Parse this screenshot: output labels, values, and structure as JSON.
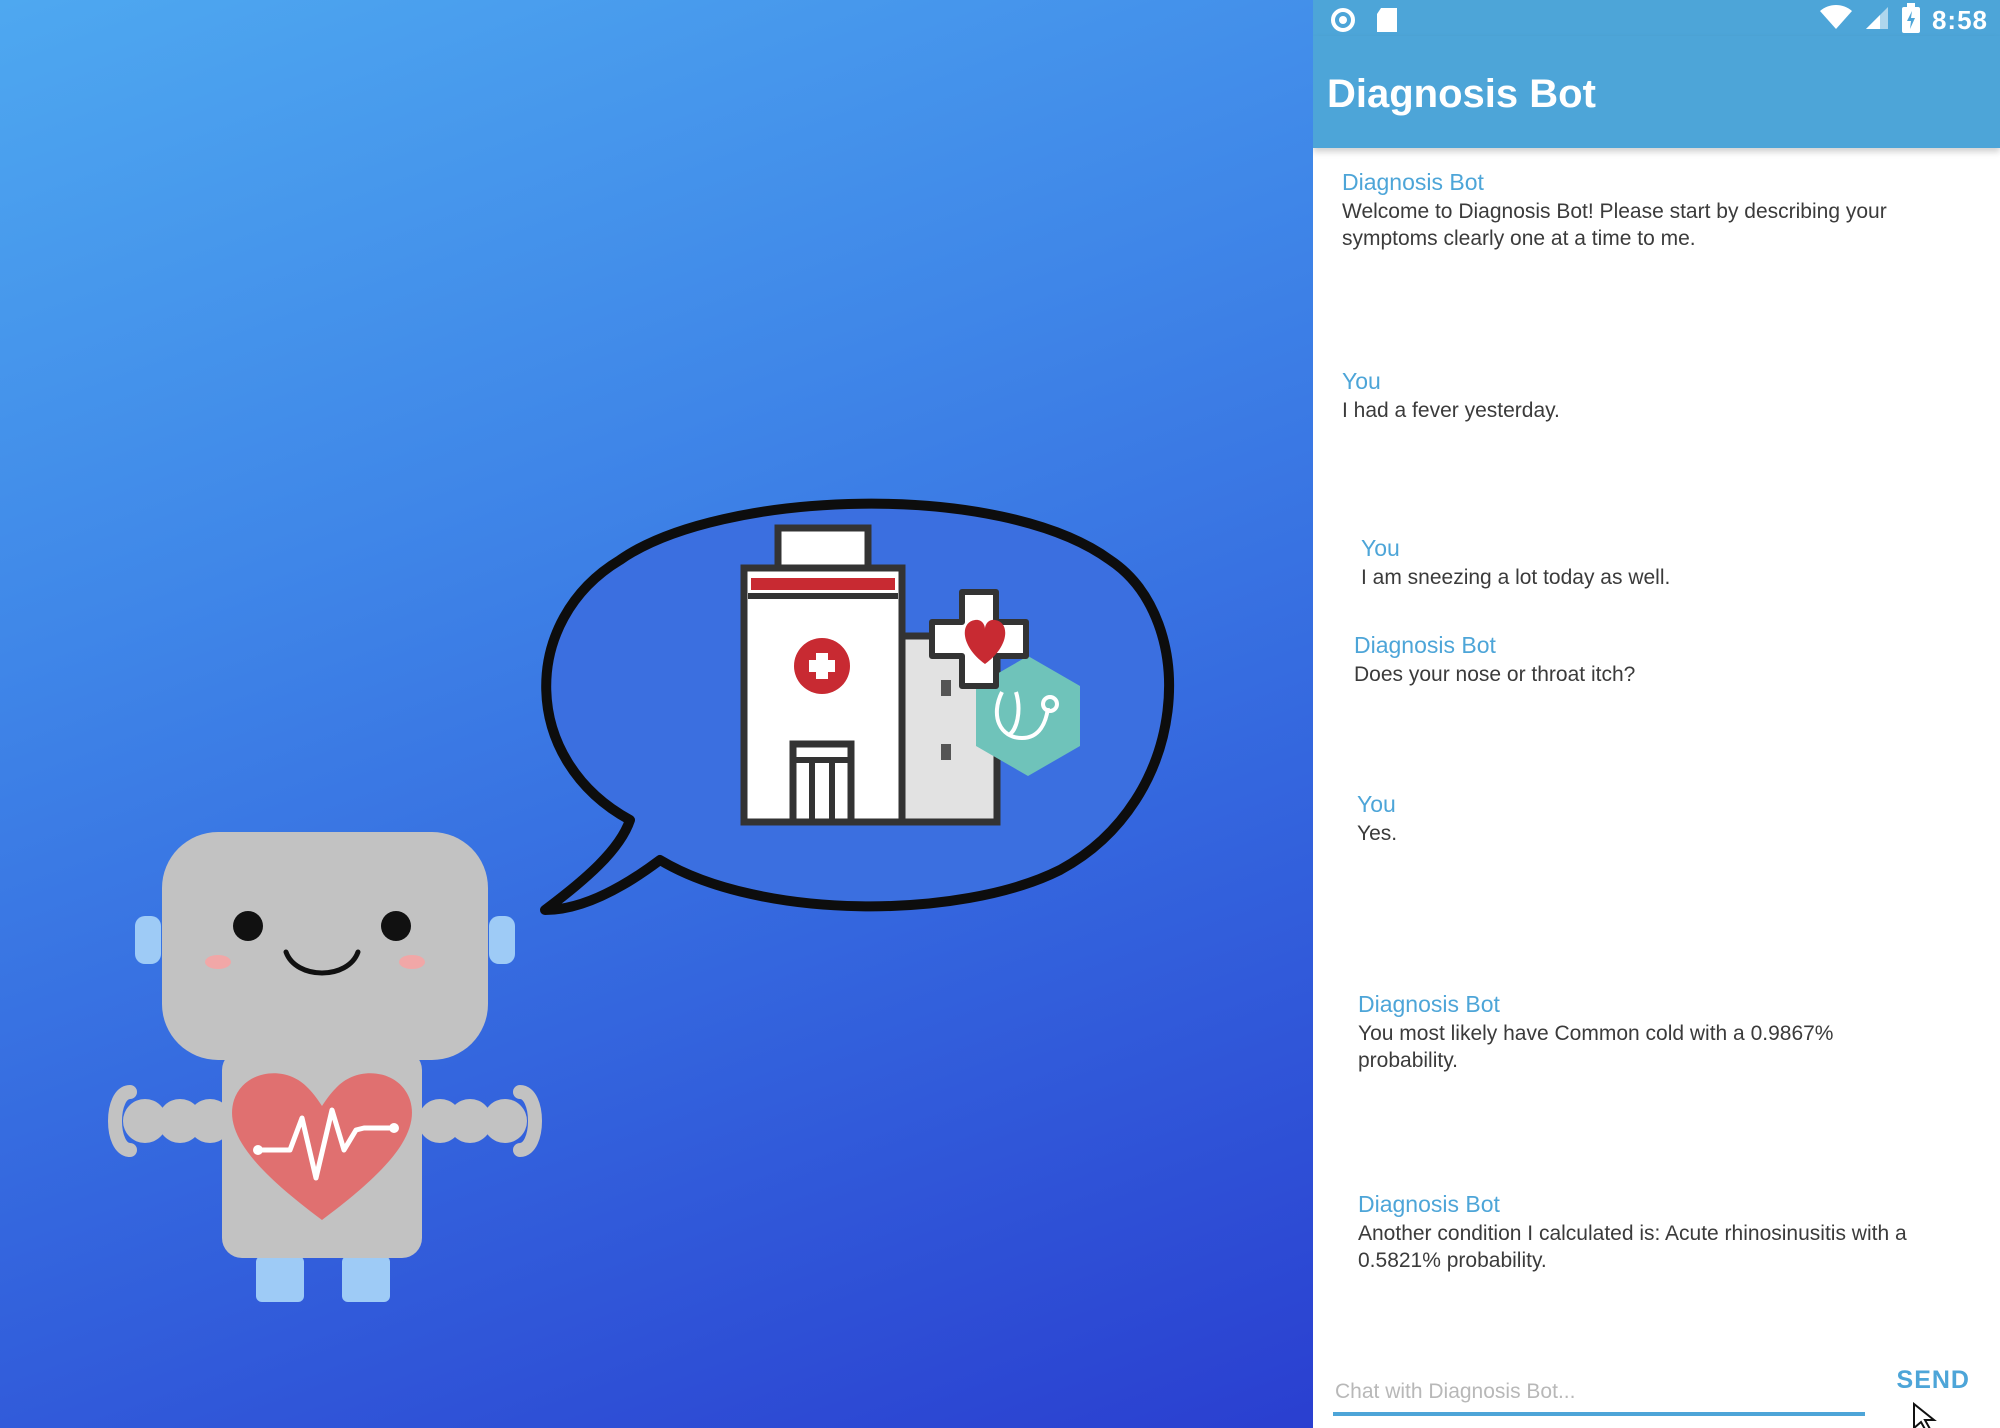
{
  "status_bar": {
    "time": "8:58",
    "left_icons": [
      "circle-status-icon",
      "sd-card-icon"
    ],
    "right_icons": [
      "wifi-icon",
      "cell-signal-icon",
      "battery-icon"
    ]
  },
  "app_bar": {
    "title": "Diagnosis Bot"
  },
  "messages": [
    {
      "sender": "Diagnosis Bot",
      "text": "Welcome to Diagnosis Bot! Please start by describing your symptoms clearly one at a time to me."
    },
    {
      "sender": "You",
      "text": "I had a fever yesterday."
    },
    {
      "sender": "You",
      "text": "I am sneezing a lot today as well."
    },
    {
      "sender": "Diagnosis Bot",
      "text": "Does your nose or throat itch?"
    },
    {
      "sender": "You",
      "text": "Yes."
    },
    {
      "sender": "Diagnosis Bot",
      "text": "You most likely have Common cold with a  0.9867% probability."
    },
    {
      "sender": "Diagnosis Bot",
      "text": "Another condition I calculated is: Acute rhinosinusitis with a  0.5821% probability."
    }
  ],
  "input": {
    "placeholder": "Chat with Diagnosis Bot...",
    "value": ""
  },
  "send_button": {
    "label": "SEND"
  },
  "colors": {
    "accent": "#4da5d8",
    "gradient_top": "#4ea8f0",
    "gradient_bottom": "#2a3fd0",
    "robot_body": "#c2c2c2",
    "heart": "#e07070",
    "hospital_red": "#c82a32",
    "stethoscope_hex": "#6fc3ba"
  },
  "illustration": {
    "robot_icon": "robot-icon",
    "speech_bubble_icon": "speech-bubble-icon",
    "hospital_icon": "hospital-icon",
    "heart_cross_icon": "heart-cross-icon",
    "stethoscope_icon": "stethoscope-icon"
  }
}
